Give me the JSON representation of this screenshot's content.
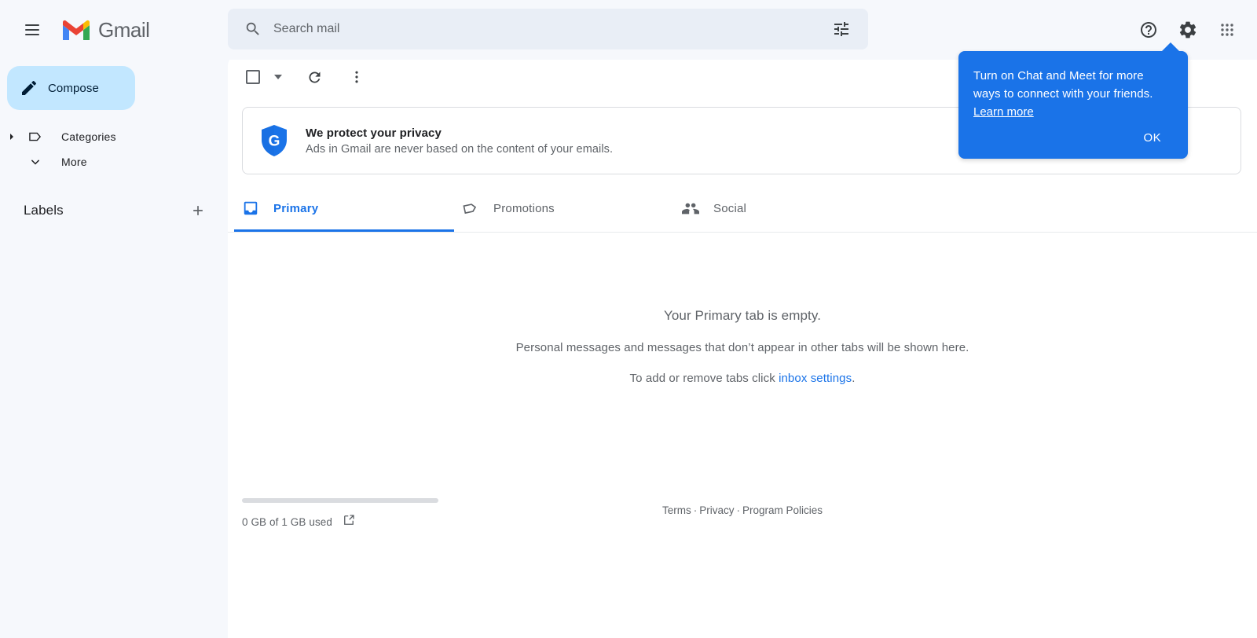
{
  "app": {
    "brand_name": "Gmail",
    "accent_color": "#1a73e8",
    "compose_bg": "#c2e7ff",
    "page_bg": "#f6f8fc"
  },
  "topbar": {
    "menu_icon": "hamburger-icon",
    "logo_icon": "gmail-logo-icon",
    "help_icon": "help-icon",
    "settings_icon": "gear-icon",
    "apps_icon": "apps-grid-icon"
  },
  "search": {
    "icon": "search-icon",
    "placeholder": "Search mail",
    "value": "",
    "filter_icon": "tune-filter-icon"
  },
  "sidebar": {
    "compose_label": "Compose",
    "compose_icon": "pencil-icon",
    "items": [
      {
        "label": "Categories",
        "icon": "tag-icon",
        "caret": "caret-right-icon"
      },
      {
        "label": "More",
        "icon": "chevron-down-icon",
        "caret": ""
      }
    ],
    "labels_title": "Labels",
    "add_label_icon": "plus-icon"
  },
  "toolbar": {
    "select_all_icon": "checkbox-icon",
    "select_all_caret": "caret-down-icon",
    "refresh_icon": "refresh-icon",
    "more_icon": "more-vertical-icon"
  },
  "privacy_banner": {
    "icon": "shield-g-icon",
    "title": "We protect your privacy",
    "subtitle": "Ads in Gmail are never based on the content of your emails."
  },
  "tabs": [
    {
      "label": "Primary",
      "icon": "inbox-icon",
      "active": true
    },
    {
      "label": "Promotions",
      "icon": "tag-icon",
      "active": false
    },
    {
      "label": "Social",
      "icon": "people-icon",
      "active": false
    }
  ],
  "empty_state": {
    "title": "Your Primary tab is empty.",
    "line1": "Personal messages and messages that don’t appear in other tabs will be shown here.",
    "line2_prefix": "To add or remove tabs click ",
    "line2_link": "inbox settings",
    "line2_suffix": "."
  },
  "footer": {
    "storage_text": "0 GB of 1 GB used",
    "storage_used_percent": 0,
    "storage_icon": "external-link-icon",
    "links": [
      {
        "label": "Terms"
      },
      {
        "label": "Privacy"
      },
      {
        "label": "Program Policies"
      }
    ],
    "separator": "·"
  },
  "tooltip": {
    "message": "Turn on Chat and Meet for more ways to connect with your friends.",
    "learn_more": "Learn more",
    "ok_label": "OK",
    "background": "#1a73e8"
  }
}
